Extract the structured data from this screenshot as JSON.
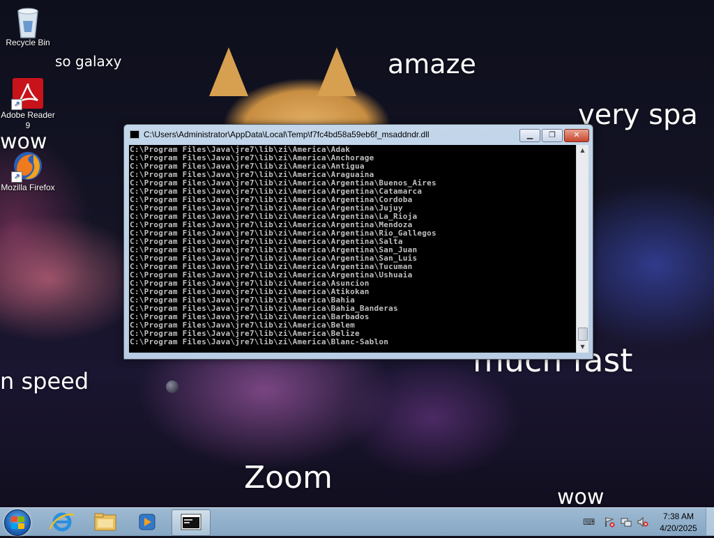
{
  "desktop": {
    "icons": [
      {
        "label": "Recycle Bin",
        "icon": "recycle-bin-icon"
      },
      {
        "label": "Adobe Reader 9",
        "icon": "adobe-reader-icon"
      },
      {
        "label": "Mozilla Firefox",
        "icon": "firefox-icon"
      }
    ],
    "wallpaper_text": [
      "so galaxy",
      "amaze",
      "very spa",
      "wow",
      "n speed",
      "much fast",
      "Zoom",
      "wow"
    ]
  },
  "console_window": {
    "title": "C:\\Users\\Administrator\\AppData\\Local\\Temp\\f7fc4bd58a59eb6f_msaddndr.dll",
    "buttons": {
      "minimize": "▁",
      "maximize": "❐",
      "close": "✕"
    },
    "lines": [
      "C:\\Program Files\\Java\\jre7\\lib\\zi\\America\\Adak",
      "C:\\Program Files\\Java\\jre7\\lib\\zi\\America\\Anchorage",
      "C:\\Program Files\\Java\\jre7\\lib\\zi\\America\\Antigua",
      "C:\\Program Files\\Java\\jre7\\lib\\zi\\America\\Araguaina",
      "C:\\Program Files\\Java\\jre7\\lib\\zi\\America\\Argentina\\Buenos_Aires",
      "C:\\Program Files\\Java\\jre7\\lib\\zi\\America\\Argentina\\Catamarca",
      "C:\\Program Files\\Java\\jre7\\lib\\zi\\America\\Argentina\\Cordoba",
      "C:\\Program Files\\Java\\jre7\\lib\\zi\\America\\Argentina\\Jujuy",
      "C:\\Program Files\\Java\\jre7\\lib\\zi\\America\\Argentina\\La_Rioja",
      "C:\\Program Files\\Java\\jre7\\lib\\zi\\America\\Argentina\\Mendoza",
      "C:\\Program Files\\Java\\jre7\\lib\\zi\\America\\Argentina\\Rio_Gallegos",
      "C:\\Program Files\\Java\\jre7\\lib\\zi\\America\\Argentina\\Salta",
      "C:\\Program Files\\Java\\jre7\\lib\\zi\\America\\Argentina\\San_Juan",
      "C:\\Program Files\\Java\\jre7\\lib\\zi\\America\\Argentina\\San_Luis",
      "C:\\Program Files\\Java\\jre7\\lib\\zi\\America\\Argentina\\Tucuman",
      "C:\\Program Files\\Java\\jre7\\lib\\zi\\America\\Argentina\\Ushuaia",
      "C:\\Program Files\\Java\\jre7\\lib\\zi\\America\\Asuncion",
      "C:\\Program Files\\Java\\jre7\\lib\\zi\\America\\Atikokan",
      "C:\\Program Files\\Java\\jre7\\lib\\zi\\America\\Bahia",
      "C:\\Program Files\\Java\\jre7\\lib\\zi\\America\\Bahia_Banderas",
      "C:\\Program Files\\Java\\jre7\\lib\\zi\\America\\Barbados",
      "C:\\Program Files\\Java\\jre7\\lib\\zi\\America\\Belem",
      "C:\\Program Files\\Java\\jre7\\lib\\zi\\America\\Belize",
      "C:\\Program Files\\Java\\jre7\\lib\\zi\\America\\Blanc-Sablon"
    ]
  },
  "taskbar": {
    "start_icon": "windows-start-icon",
    "pinned": [
      "internet-explorer-icon",
      "file-explorer-icon",
      "media-player-icon",
      "console-window-icon"
    ],
    "tray_icons": [
      "keyboard-icon",
      "action-center-flag-icon",
      "network-icon",
      "volume-muted-icon"
    ],
    "time": "7:38 AM",
    "date": "4/20/2025"
  },
  "colors": {
    "console_bg": "#000000",
    "console_text": "#c0c0c0",
    "window_frame": "#b8cce3",
    "taskbar": "#9fbdd8"
  }
}
